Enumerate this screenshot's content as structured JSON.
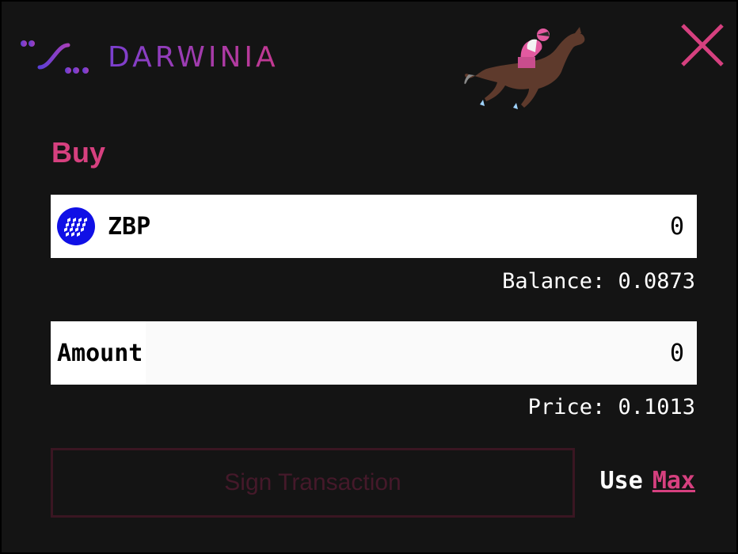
{
  "brand": {
    "name": "DARWINIA"
  },
  "close": {
    "icon": "close-x-icon",
    "color": "#d6407f"
  },
  "form": {
    "title": "Buy",
    "token": {
      "symbol": "ZBP",
      "value": "0",
      "icon": "token-grid-icon",
      "icon_color": "#1010e6"
    },
    "balance_text": "Balance: 0.0873",
    "amount": {
      "label": "Amount",
      "value": "0"
    },
    "price_text": "Price: 0.1013",
    "sign_button": "Sign Transaction",
    "use_label": "Use",
    "max_label": "Max"
  },
  "colors": {
    "accent": "#d6407f",
    "background": "#141414"
  }
}
